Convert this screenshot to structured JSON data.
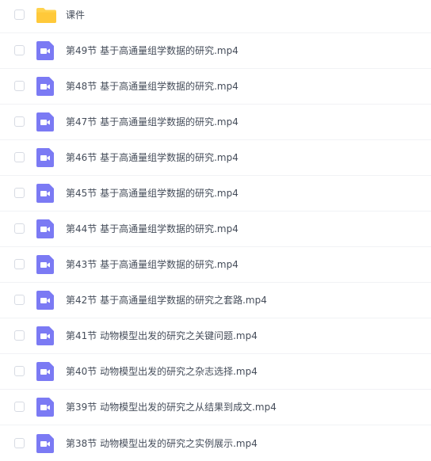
{
  "files": [
    {
      "type": "folder",
      "name": "课件"
    },
    {
      "type": "video",
      "name": "第49节 基于高通量组学数据的研究.mp4"
    },
    {
      "type": "video",
      "name": "第48节 基于高通量组学数据的研究.mp4"
    },
    {
      "type": "video",
      "name": "第47节 基于高通量组学数据的研究.mp4"
    },
    {
      "type": "video",
      "name": "第46节 基于高通量组学数据的研究.mp4"
    },
    {
      "type": "video",
      "name": "第45节 基于高通量组学数据的研究.mp4"
    },
    {
      "type": "video",
      "name": "第44节 基于高通量组学数据的研究.mp4"
    },
    {
      "type": "video",
      "name": "第43节 基于高通量组学数据的研究.mp4"
    },
    {
      "type": "video",
      "name": "第42节 基于高通量组学数据的研究之套路.mp4"
    },
    {
      "type": "video",
      "name": "第41节 动物模型出发的研究之关键问题.mp4"
    },
    {
      "type": "video",
      "name": "第40节 动物模型出发的研究之杂志选择.mp4"
    },
    {
      "type": "video",
      "name": "第39节 动物模型出发的研究之从结果到成文.mp4"
    },
    {
      "type": "video",
      "name": "第38节 动物模型出发的研究之实例展示.mp4"
    }
  ],
  "colors": {
    "folder": "#ffd24d",
    "video": "#7b7af4",
    "text": "#454d5a",
    "divider": "#f1f2f5"
  }
}
